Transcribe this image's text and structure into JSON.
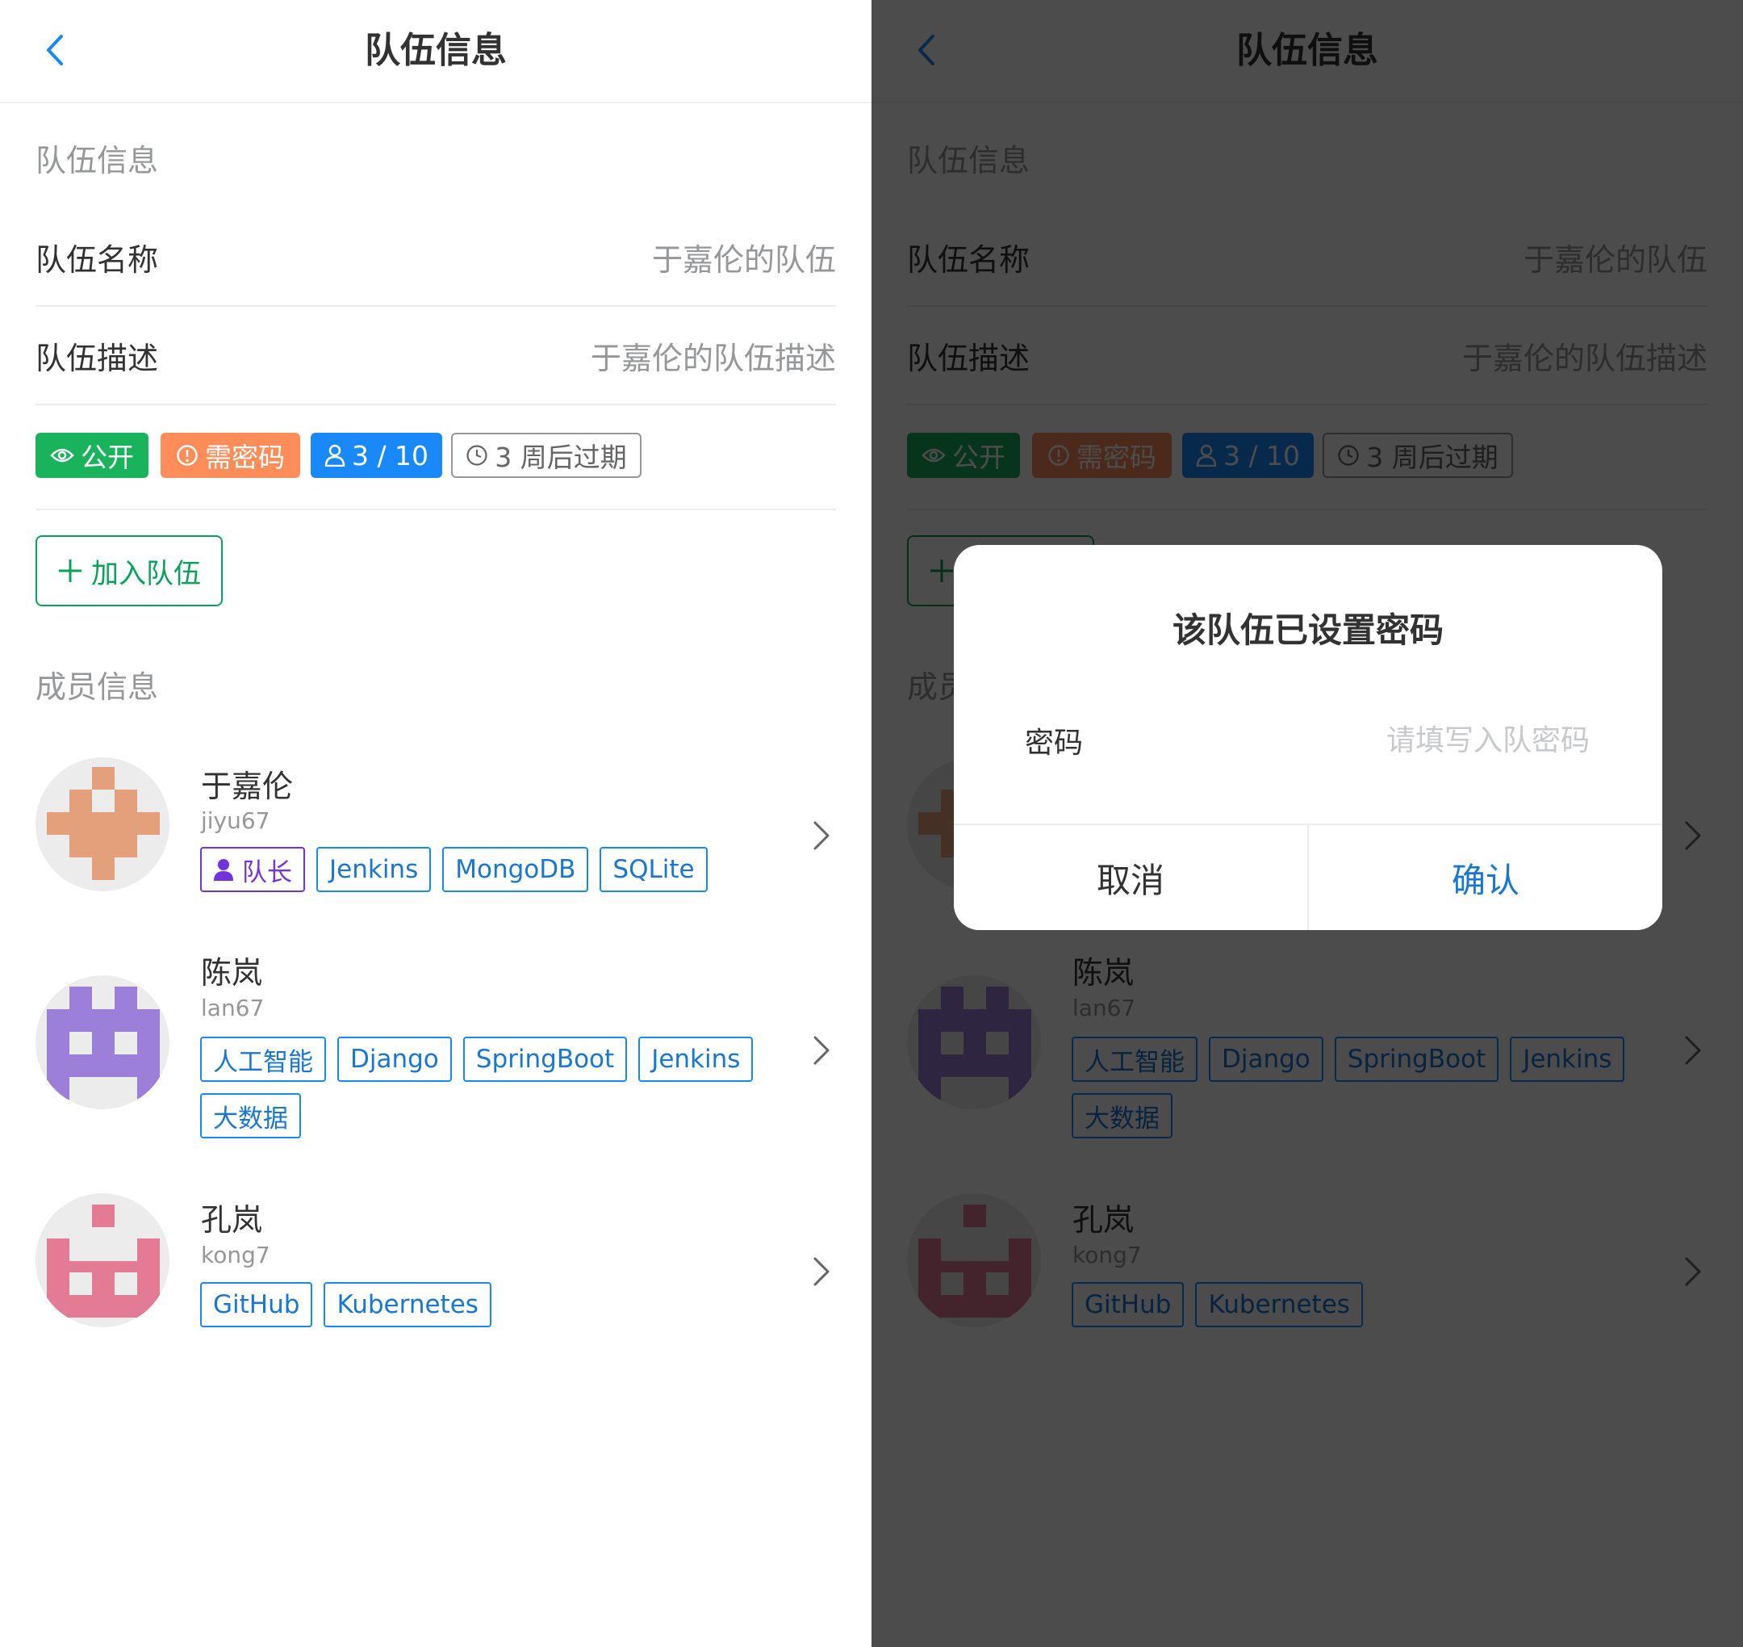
{
  "header": {
    "title": "队伍信息"
  },
  "team": {
    "section_title": "队伍信息",
    "name_label": "队伍名称",
    "name_value": "于嘉伦的队伍",
    "desc_label": "队伍描述",
    "desc_value": "于嘉伦的队伍描述",
    "badges": {
      "public": "公开",
      "password": "需密码",
      "members": "3 / 10",
      "expire": "3 周后过期"
    },
    "join_button": "加入队伍"
  },
  "members_section_title": "成员信息",
  "members": [
    {
      "name": "于嘉伦",
      "username": "jiyu67",
      "leader_tag": "队长",
      "tags": [
        "Jenkins",
        "MongoDB",
        "SQLite"
      ],
      "avatar_color": "#e3a07a"
    },
    {
      "name": "陈岚",
      "username": "lan67",
      "tags": [
        "人工智能",
        "Django",
        "SpringBoot",
        "Jenkins",
        "大数据"
      ],
      "avatar_color": "#9b7fd8"
    },
    {
      "name": "孔岚",
      "username": "kong7",
      "tags": [
        "GitHub",
        "Kubernetes"
      ],
      "avatar_color": "#e37b95"
    }
  ],
  "dialog": {
    "title": "该队伍已设置密码",
    "password_label": "密码",
    "password_placeholder": "请填写入队密码",
    "password_value": "",
    "cancel": "取消",
    "confirm": "确认"
  },
  "colors": {
    "primary": "#1989fa",
    "success": "#07a35a",
    "warning": "#ff8d5a",
    "leader": "#7232dd",
    "overlay": "rgba(0,0,0,0.7)"
  }
}
